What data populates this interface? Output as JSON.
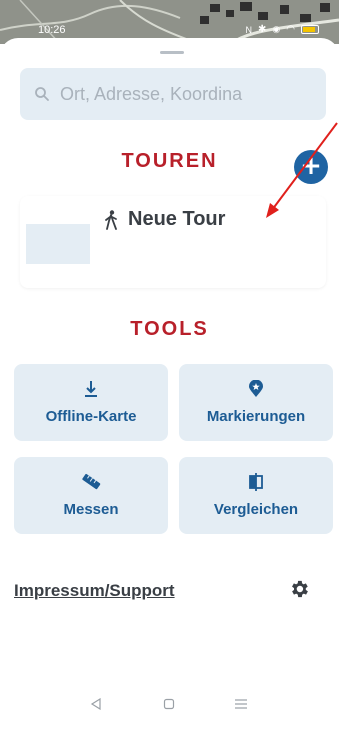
{
  "status_bar": {
    "time": "10:26",
    "icons": [
      "nfc-icon",
      "bluetooth-icon",
      "location-icon",
      "wifi-icon",
      "battery-icon"
    ]
  },
  "search": {
    "placeholder": "Ort, Adresse, Koordina",
    "icon": "search-icon"
  },
  "touren": {
    "title": "TOUREN",
    "add_icon": "plus-icon",
    "add_symbol": "+",
    "tour": {
      "name": "Neue Tour",
      "icon": "hiker-icon"
    }
  },
  "tools": {
    "title": "TOOLS",
    "items": [
      {
        "label": "Offline-Karte",
        "icon": "download-icon"
      },
      {
        "label": "Markierungen",
        "icon": "map-marker-star-icon"
      },
      {
        "label": "Messen",
        "icon": "ruler-icon"
      },
      {
        "label": "Vergleichen",
        "icon": "compare-icon"
      }
    ]
  },
  "footer": {
    "impressum_label": "Impressum/Support",
    "settings_icon": "gear-icon"
  },
  "nav_bar": {
    "icons": [
      "back-icon",
      "home-icon",
      "menu-icon"
    ]
  },
  "colors": {
    "accent_red": "#b8202a",
    "primary_blue": "#1d5c94",
    "button_bg": "#e4edf4",
    "annotation_arrow": "#e0201c"
  }
}
